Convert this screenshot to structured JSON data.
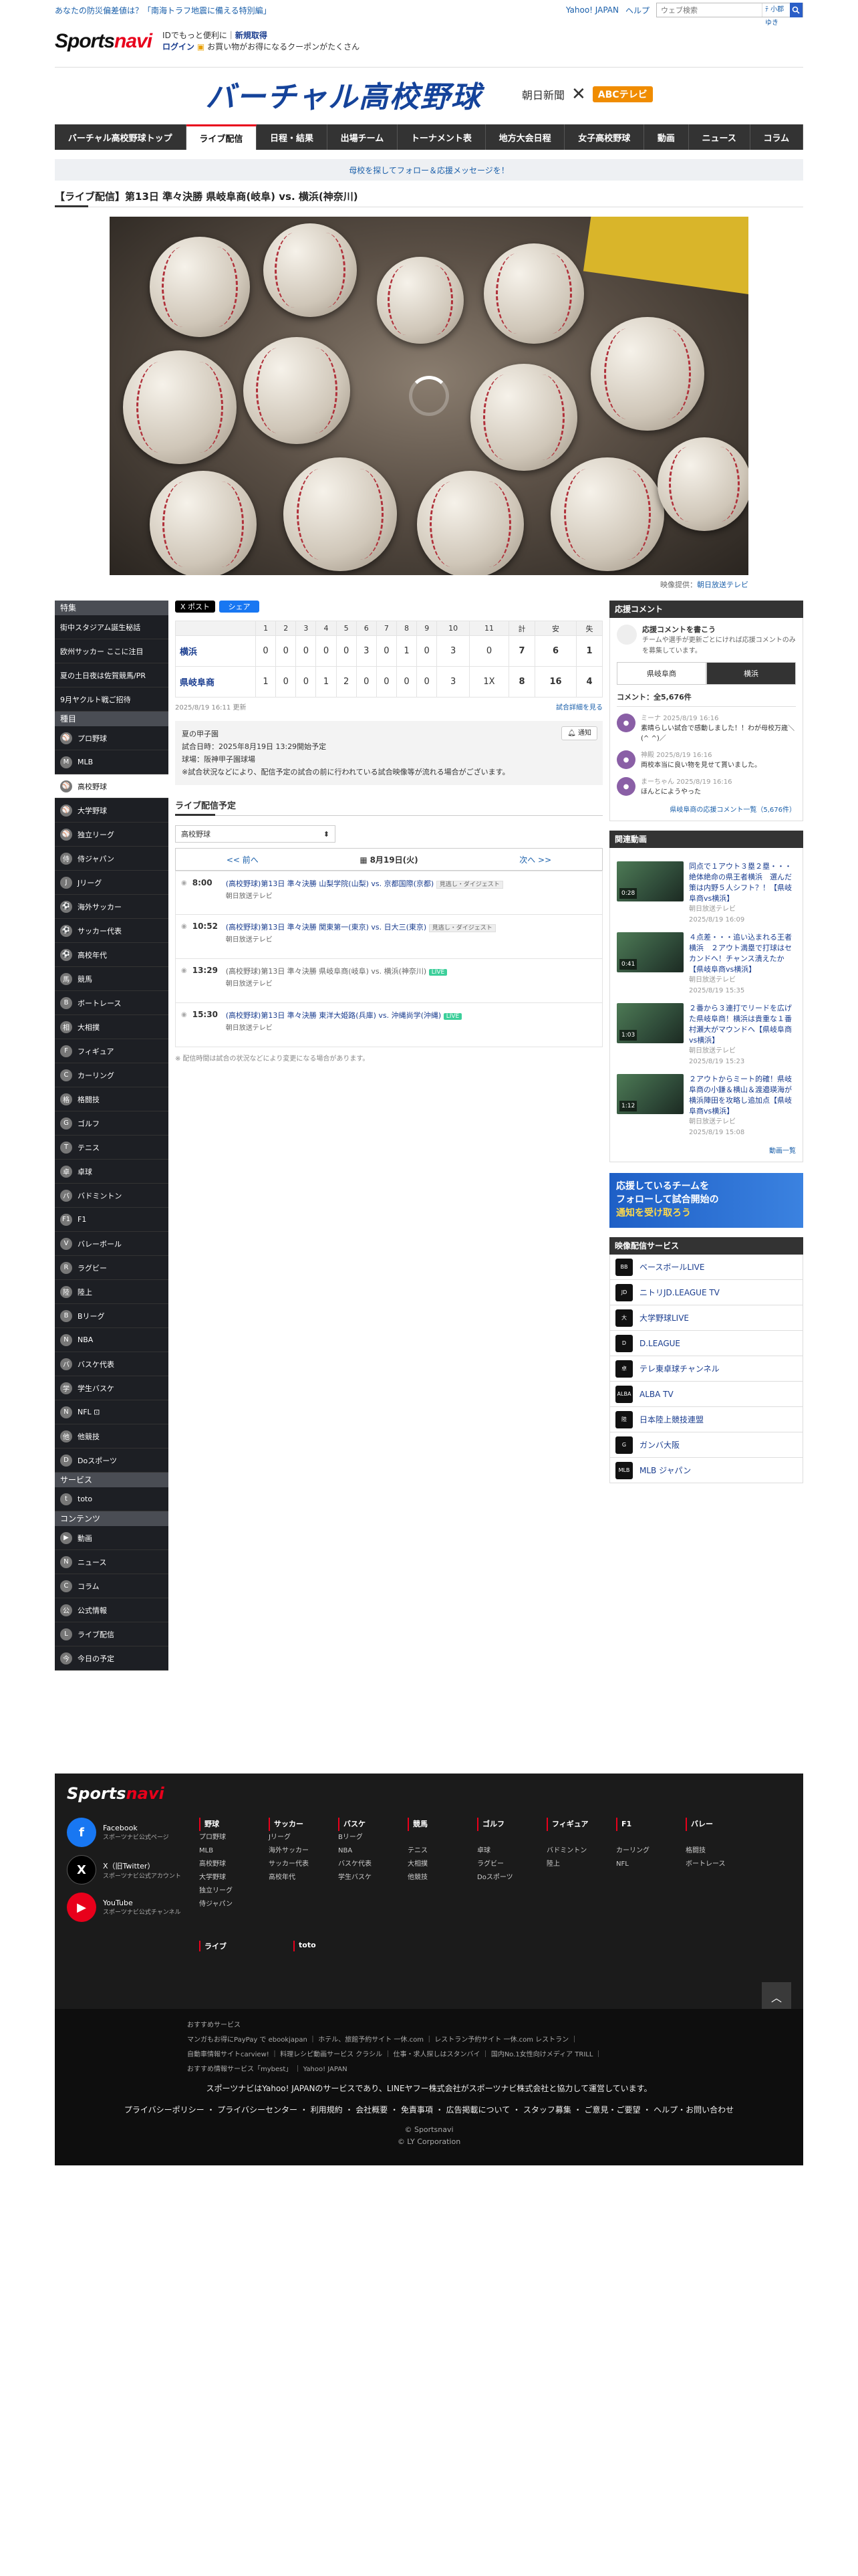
{
  "topbar": {
    "left_link": "あなたの防災偏差値は？「南海トラフ地震に備える特別編」",
    "yahoo": "Yahoo! JAPAN",
    "help": "ヘルプ",
    "search_placeholder": "ウェブ検索",
    "search_tab": "ﾃ 小郡ゆき"
  },
  "header": {
    "logo_main": "Sports",
    "logo_accent": "navi",
    "id_line": "IDでもっと便利に",
    "id_register": "新規取得",
    "login": "ログイン",
    "coupon": "お買い物がお得になるクーポンがたくさん"
  },
  "banner": {
    "title": "バーチャル高校野球",
    "partner1": "朝日新聞",
    "x": "✕",
    "partner2": "ABCテレビ"
  },
  "nav": [
    "バーチャル高校野球トップ",
    "ライブ配信",
    "日程・結果",
    "出場チーム",
    "トーナメント表",
    "地方大会日程",
    "女子高校野球",
    "動画",
    "ニュース",
    "コラム"
  ],
  "notice": "母校を探してフォロー＆応援メッセージを！",
  "page_title": "【ライブ配信】第13日 準々決勝 県岐阜商(岐阜) vs. 横浜(神奈川)",
  "video_credit_label": "映像提供：",
  "video_credit": "朝日放送テレビ",
  "left_nav": {
    "sec1": "特集",
    "features": [
      "街中スタジアム誕生秘話",
      "欧州サッカー ここに注目",
      "夏の土日夜は佐賀競馬/PR",
      "9月ヤクルト戦ご招待"
    ],
    "sec2": "種目",
    "sports": [
      [
        "プロ野球",
        "⚾"
      ],
      [
        "MLB",
        "M"
      ],
      [
        "高校野球",
        "⚾"
      ],
      [
        "大学野球",
        "⚾"
      ],
      [
        "独立リーグ",
        "⚾"
      ],
      [
        "侍ジャパン",
        "侍"
      ],
      [
        "Jリーグ",
        "J"
      ],
      [
        "海外サッカー",
        "⚽"
      ],
      [
        "サッカー代表",
        "⚽"
      ],
      [
        "高校年代",
        "⚽"
      ],
      [
        "競馬",
        "馬"
      ],
      [
        "ボートレース",
        "B"
      ],
      [
        "大相撲",
        "相"
      ],
      [
        "フィギュア",
        "F"
      ],
      [
        "カーリング",
        "C"
      ],
      [
        "格闘技",
        "格"
      ],
      [
        "ゴルフ",
        "G"
      ],
      [
        "テニス",
        "T"
      ],
      [
        "卓球",
        "卓"
      ],
      [
        "バドミントン",
        "バ"
      ],
      [
        "F1",
        "F1"
      ],
      [
        "バレーボール",
        "V"
      ],
      [
        "ラグビー",
        "R"
      ],
      [
        "陸上",
        "陸"
      ],
      [
        "Bリーグ",
        "B"
      ],
      [
        "NBA",
        "N"
      ],
      [
        "バスケ代表",
        "バ"
      ],
      [
        "学生バスケ",
        "学"
      ],
      [
        "NFL ⊡",
        "N"
      ],
      [
        "他競技",
        "他"
      ],
      [
        "Doスポーツ",
        "D"
      ]
    ],
    "sec3": "サービス",
    "services": [
      [
        "toto",
        "t"
      ]
    ],
    "sec4": "コンテンツ",
    "contents": [
      [
        "動画",
        "▶"
      ],
      [
        "ニュース",
        "N"
      ],
      [
        "コラム",
        "C"
      ],
      [
        "公式情報",
        "公"
      ],
      [
        "ライブ配信",
        "L"
      ],
      [
        "今日の予定",
        "今"
      ]
    ]
  },
  "share": {
    "x": "X ポスト",
    "fb": "シェア"
  },
  "scoreboard": {
    "innings": [
      "1",
      "2",
      "3",
      "4",
      "5",
      "6",
      "7",
      "8",
      "9",
      "10",
      "11",
      "計",
      "安",
      "失"
    ],
    "rows": [
      {
        "team": "横浜",
        "scores": [
          "0",
          "0",
          "0",
          "0",
          "0",
          "3",
          "0",
          "1",
          "0",
          "3",
          "0",
          "7",
          "6",
          "1"
        ]
      },
      {
        "team": "県岐阜商",
        "scores": [
          "1",
          "0",
          "0",
          "1",
          "2",
          "0",
          "0",
          "0",
          "0",
          "3",
          "1X",
          "8",
          "16",
          "4"
        ]
      }
    ],
    "updated": "2025/8/19 16:11 更新",
    "detail_link": "試合詳細を見る"
  },
  "info": {
    "l1": "夏の甲子園",
    "l2": "試合日時：2025年8月19日 13:29開始予定",
    "l3": "球場：阪神甲子園球場",
    "l4": "※試合状況などにより、配信予定の試合の前に行われている試合映像等が流れる場合がございます。",
    "notify": "通知"
  },
  "schedule": {
    "heading": "ライブ配信予定",
    "select": "高校野球",
    "prev": "<< 前へ",
    "date": "8月19日(火)",
    "next": "次へ >>",
    "items": [
      {
        "time": "8:00",
        "title": "(高校野球)第13日 準々決勝 山梨学院(山梨) vs. 京都国際(京都)",
        "tag": "見逃し・ダイジェスト",
        "live": "",
        "sub": "朝日放送テレビ",
        "link": true
      },
      {
        "time": "10:52",
        "title": "(高校野球)第13日 準々決勝 関東第一(東京) vs. 日大三(東京)",
        "tag": "見逃し・ダイジェスト",
        "live": "",
        "sub": "朝日放送テレビ",
        "link": true
      },
      {
        "time": "13:29",
        "title": "(高校野球)第13日 準々決勝 県岐阜商(岐阜) vs. 横浜(神奈川)",
        "tag": "",
        "live": "LIVE",
        "sub": "朝日放送テレビ",
        "link": false
      },
      {
        "time": "15:30",
        "title": "(高校野球)第13日 準々決勝 東洋大姫路(兵庫) vs. 沖縄尚学(沖縄)",
        "tag": "",
        "live": "LIVE",
        "sub": "朝日放送テレビ",
        "link": true
      }
    ],
    "note": "※ 配信時間は試合の状況などにより変更になる場合があります。"
  },
  "right": {
    "cheer_head": "応援コメント",
    "cheer_title": "応援コメントを書こう",
    "cheer_desc": "チームや選手が更新ごとにければ応援コメントのみを募集しています。",
    "tab1": "県岐阜商",
    "tab2": "横浜",
    "count": "コメント：全5,676件",
    "comments": [
      {
        "name": "ミーナ",
        "time": "2025/8/19 16:16",
        "text": "素晴らしい試合で感動しました！！わが母校万歳＼(^ ^)／"
      },
      {
        "name": "神殿",
        "time": "2025/8/19 16:16",
        "text": "両校本当に良い物を見せて貰いました。"
      },
      {
        "name": "まーちゃん",
        "time": "2025/8/19 16:16",
        "text": "ほんとにようやった"
      }
    ],
    "comment_link": "県岐阜商の応援コメント一覧（5,676件）",
    "video_head": "関連動画",
    "videos": [
      {
        "title": "同点で１アウト３塁２塁・・・絶体絶命の県王者横浜　選んだ策は内野５人シフト？！【県岐阜商vs横浜】",
        "src": "朝日放送テレビ",
        "time": "2025/8/19 16:09",
        "dur": "0:28"
      },
      {
        "title": "４点差・・・追い込まれる王者横浜　２アウト満塁で打球はセカンドへ！チャンス潰えたか【県岐阜商vs横浜】",
        "src": "朝日放送テレビ",
        "time": "2025/8/19 15:35",
        "dur": "0:41"
      },
      {
        "title": "２番から３連打でリードを広げた県岐阜商！横浜は貴重な１番村瀬大がマウンドへ【県岐阜商vs横浜】",
        "src": "朝日放送テレビ",
        "time": "2025/8/19 15:23",
        "dur": "1:03"
      },
      {
        "title": "２アウトからミート的確！県岐阜商の小鎌＆横山＆渡邉瑛海が横浜陣田を攻略し追加点【県岐阜商vs横浜】",
        "src": "朝日放送テレビ",
        "time": "2025/8/19 15:08",
        "dur": "1:12"
      }
    ],
    "video_more": "動画一覧",
    "promo1": "応援しているチームを",
    "promo2": "フォローして試合開始の",
    "promo3": "通知を受け取ろう",
    "svc_head": "映像配信サービス",
    "services": [
      [
        "ベースボールLIVE",
        "BB"
      ],
      [
        "ニトリJD.LEAGUE TV",
        "JD"
      ],
      [
        "大学野球LIVE",
        "大"
      ],
      [
        "D.LEAGUE",
        "D"
      ],
      [
        "テレ東卓球チャンネル",
        "卓"
      ],
      [
        "ALBA TV",
        "ALBA"
      ],
      [
        "日本陸上競技連盟",
        "陸"
      ],
      [
        "ガンバ大阪",
        "G"
      ],
      [
        "MLB ジャパン",
        "MLB"
      ]
    ]
  },
  "footer": {
    "logo_main": "Sports",
    "logo_accent": "navi",
    "social": [
      [
        "Facebook",
        "スポーツナビ公式ページ",
        "f",
        "#1877f2"
      ],
      [
        "X（旧Twitter）",
        "スポーツナビ公式アカウント",
        "X",
        "#000"
      ],
      [
        "YouTube",
        "スポーツナビ公式チャンネル",
        "▶",
        "#e8001b"
      ]
    ],
    "cols": [
      {
        "h": "野球",
        "items": [
          "プロ野球",
          "MLB",
          "高校野球",
          "大学野球",
          "独立リーグ",
          "侍ジャパン"
        ]
      },
      {
        "h": "サッカー",
        "items": [
          "Jリーグ",
          "海外サッカー",
          "サッカー代表",
          "高校年代"
        ]
      },
      {
        "h": "バスケ",
        "items": [
          "Bリーグ",
          "NBA",
          "バスケ代表",
          "学生バスケ"
        ]
      },
      {
        "h": "競馬",
        "items": [
          "",
          "テニス",
          "大相撲",
          "他競技"
        ]
      },
      {
        "h": "ゴルフ",
        "items": [
          "",
          "卓球",
          "ラグビー",
          "Doスポーツ"
        ]
      },
      {
        "h": "フィギュア",
        "items": [
          "",
          "バドミントン",
          "陸上",
          ""
        ]
      },
      {
        "h": "F1",
        "items": [
          "",
          "カーリング",
          "NFL",
          ""
        ]
      },
      {
        "h": "バレー",
        "items": [
          "",
          "格闘技",
          "ボートレース",
          ""
        ]
      }
    ],
    "live": "ライブ",
    "toto": "toto",
    "rec": "おすすめサービス",
    "rec1": "マンガもお得にPayPay で ebookjapan ｜ ホテル、旅館予約サイト 一休.com ｜ レストラン予約サイト 一休.com レストラン ｜",
    "rec2": "自動車情報サイトcarview! ｜ 料理レシピ動画サービス クラシル ｜ 仕事・求人探しはスタンバイ ｜ 国内No.1女性向けメディア TRILL ｜",
    "rec3": "おすすめ情報サービス「mybest」 ｜ Yahoo! JAPAN",
    "joint": "スポーツナビはYahoo! JAPANのサービスであり、LINEヤフー株式会社がスポーツナビ株式会社と協力して運営しています。",
    "policy": "プライバシーポリシー ・ プライバシーセンター ・ 利用規約 ・ 会社概要 ・ 免責事項 ・ 広告掲載について ・ スタッフ募集 ・ ご意見・ご要望 ・ ヘルプ・お問い合わせ",
    "c1": "© Sportsnavi",
    "c2": "© LY Corporation"
  }
}
